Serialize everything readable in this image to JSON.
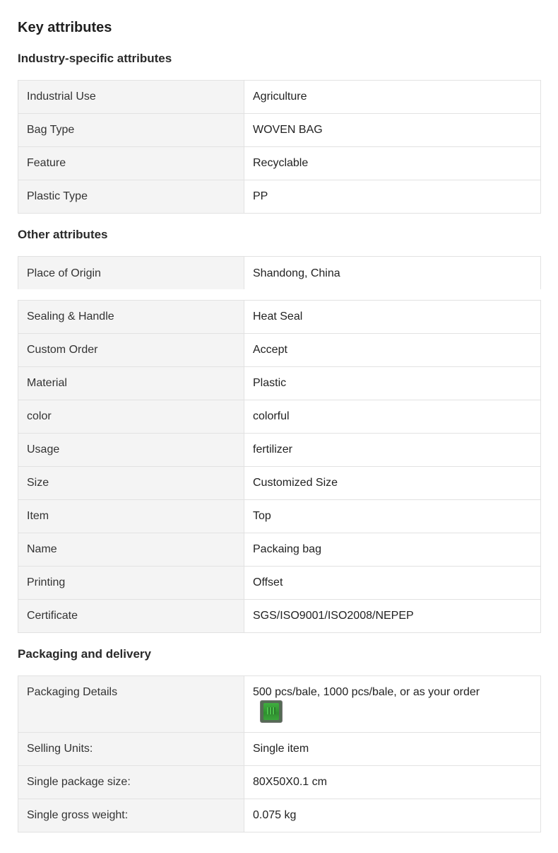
{
  "title": "Key attributes",
  "industry": {
    "heading": "Industry-specific attributes",
    "rows": [
      {
        "key": "Industrial Use",
        "value": "Agriculture"
      },
      {
        "key": "Bag Type",
        "value": "WOVEN BAG"
      },
      {
        "key": "Feature",
        "value": "Recyclable"
      },
      {
        "key": "Plastic Type",
        "value": "PP"
      }
    ]
  },
  "other": {
    "heading": "Other attributes",
    "first": {
      "key": "Place of Origin",
      "value": "Shandong, China"
    },
    "rows": [
      {
        "key": "Sealing & Handle",
        "value": "Heat Seal"
      },
      {
        "key": "Custom Order",
        "value": "Accept"
      },
      {
        "key": "Material",
        "value": "Plastic"
      },
      {
        "key": "color",
        "value": "colorful"
      },
      {
        "key": "Usage",
        "value": "fertilizer"
      },
      {
        "key": "Size",
        "value": "Customized Size"
      },
      {
        "key": "Item",
        "value": "Top"
      },
      {
        "key": "Name",
        "value": "Packaing bag"
      },
      {
        "key": "Printing",
        "value": "Offset"
      },
      {
        "key": "Certificate",
        "value": "SGS/ISO9001/ISO2008/NEPEP"
      }
    ]
  },
  "packaging": {
    "heading": "Packaging and delivery",
    "details": {
      "key": "Packaging Details",
      "value": "500 pcs/bale, 1000 pcs/bale, or as your order",
      "icon": "bag-thumbnail-icon"
    },
    "rows": [
      {
        "key": "Selling Units:",
        "value": "Single item"
      },
      {
        "key": "Single package size:",
        "value": "80X50X0.1 cm"
      },
      {
        "key": "Single gross weight:",
        "value": "0.075 kg"
      }
    ]
  }
}
